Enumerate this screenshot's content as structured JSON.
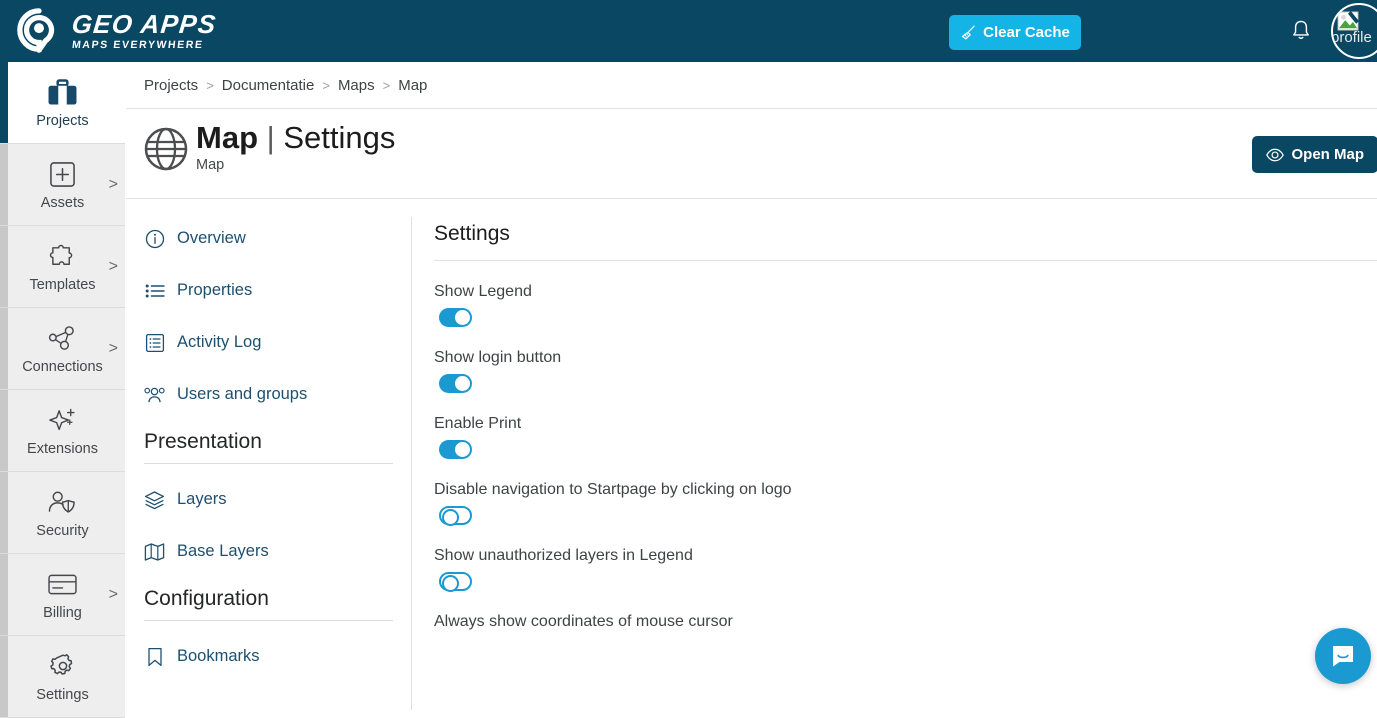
{
  "header": {
    "logo_title": "GEO APPS",
    "logo_subtitle": "MAPS EVERYWHERE",
    "logo_icon": "map-pin-circle-logo",
    "clear_cache_label": "Clear Cache",
    "clear_cache_icon": "broom-icon",
    "clear_cache_color": "#14b4e6",
    "bell_icon": "notification-bell-icon",
    "avatar_alt": "profile",
    "avatar_icon": "broken-image-icon",
    "background_color": "#094763"
  },
  "rail": {
    "items": [
      {
        "label": "Projects",
        "icon": "briefcase-icon",
        "active": true,
        "chevron": ""
      },
      {
        "label": "Assets",
        "icon": "plus-box-icon",
        "active": false,
        "chevron": ">"
      },
      {
        "label": "Templates",
        "icon": "puzzle-icon",
        "active": false,
        "chevron": ">"
      },
      {
        "label": "Connections",
        "icon": "network-icon",
        "active": false,
        "chevron": ">"
      },
      {
        "label": "Extensions",
        "icon": "sparkle-plus-icon",
        "active": false,
        "chevron": ""
      },
      {
        "label": "Security",
        "icon": "user-shield-icon",
        "active": false,
        "chevron": ""
      },
      {
        "label": "Billing",
        "icon": "credit-card-icon",
        "active": false,
        "chevron": ">"
      },
      {
        "label": "Settings",
        "icon": "gear-icon",
        "active": false,
        "chevron": ""
      }
    ]
  },
  "breadcrumb": {
    "separator": ">",
    "items": [
      "Projects",
      "Documentatie",
      "Maps",
      "Map"
    ]
  },
  "page": {
    "icon": "globe-icon",
    "title_bold": "Map",
    "title_separator": "|",
    "title_light": "Settings",
    "subtitle": "Map",
    "open_map_label": "Open Map",
    "open_map_icon": "eye-icon",
    "open_map_color": "#094763"
  },
  "content_nav": {
    "top_items": [
      {
        "label": "Overview",
        "icon": "info-circle-icon"
      },
      {
        "label": "Properties",
        "icon": "list-bullets-icon"
      },
      {
        "label": "Activity Log",
        "icon": "log-document-icon"
      },
      {
        "label": "Users and groups",
        "icon": "users-group-icon"
      }
    ],
    "groups": [
      {
        "title": "Presentation",
        "items": [
          {
            "label": "Layers",
            "icon": "layers-icon"
          },
          {
            "label": "Base Layers",
            "icon": "map-fold-icon"
          }
        ]
      },
      {
        "title": "Configuration",
        "items": [
          {
            "label": "Bookmarks",
            "icon": "bookmark-icon"
          }
        ]
      }
    ]
  },
  "settings": {
    "heading": "Settings",
    "toggle_on_color": "#1b9ad1",
    "rows": [
      {
        "label": "Show Legend",
        "state": "on"
      },
      {
        "label": "Show login button",
        "state": "on"
      },
      {
        "label": "Enable Print",
        "state": "on"
      },
      {
        "label": "Disable navigation to Startpage by clicking on logo",
        "state": "off"
      },
      {
        "label": "Show unauthorized layers in Legend",
        "state": "off"
      },
      {
        "label": "Always show coordinates of mouse cursor",
        "state": "off"
      }
    ]
  },
  "chat": {
    "icon": "chat-bubble-icon",
    "color": "#1b9ad1"
  }
}
